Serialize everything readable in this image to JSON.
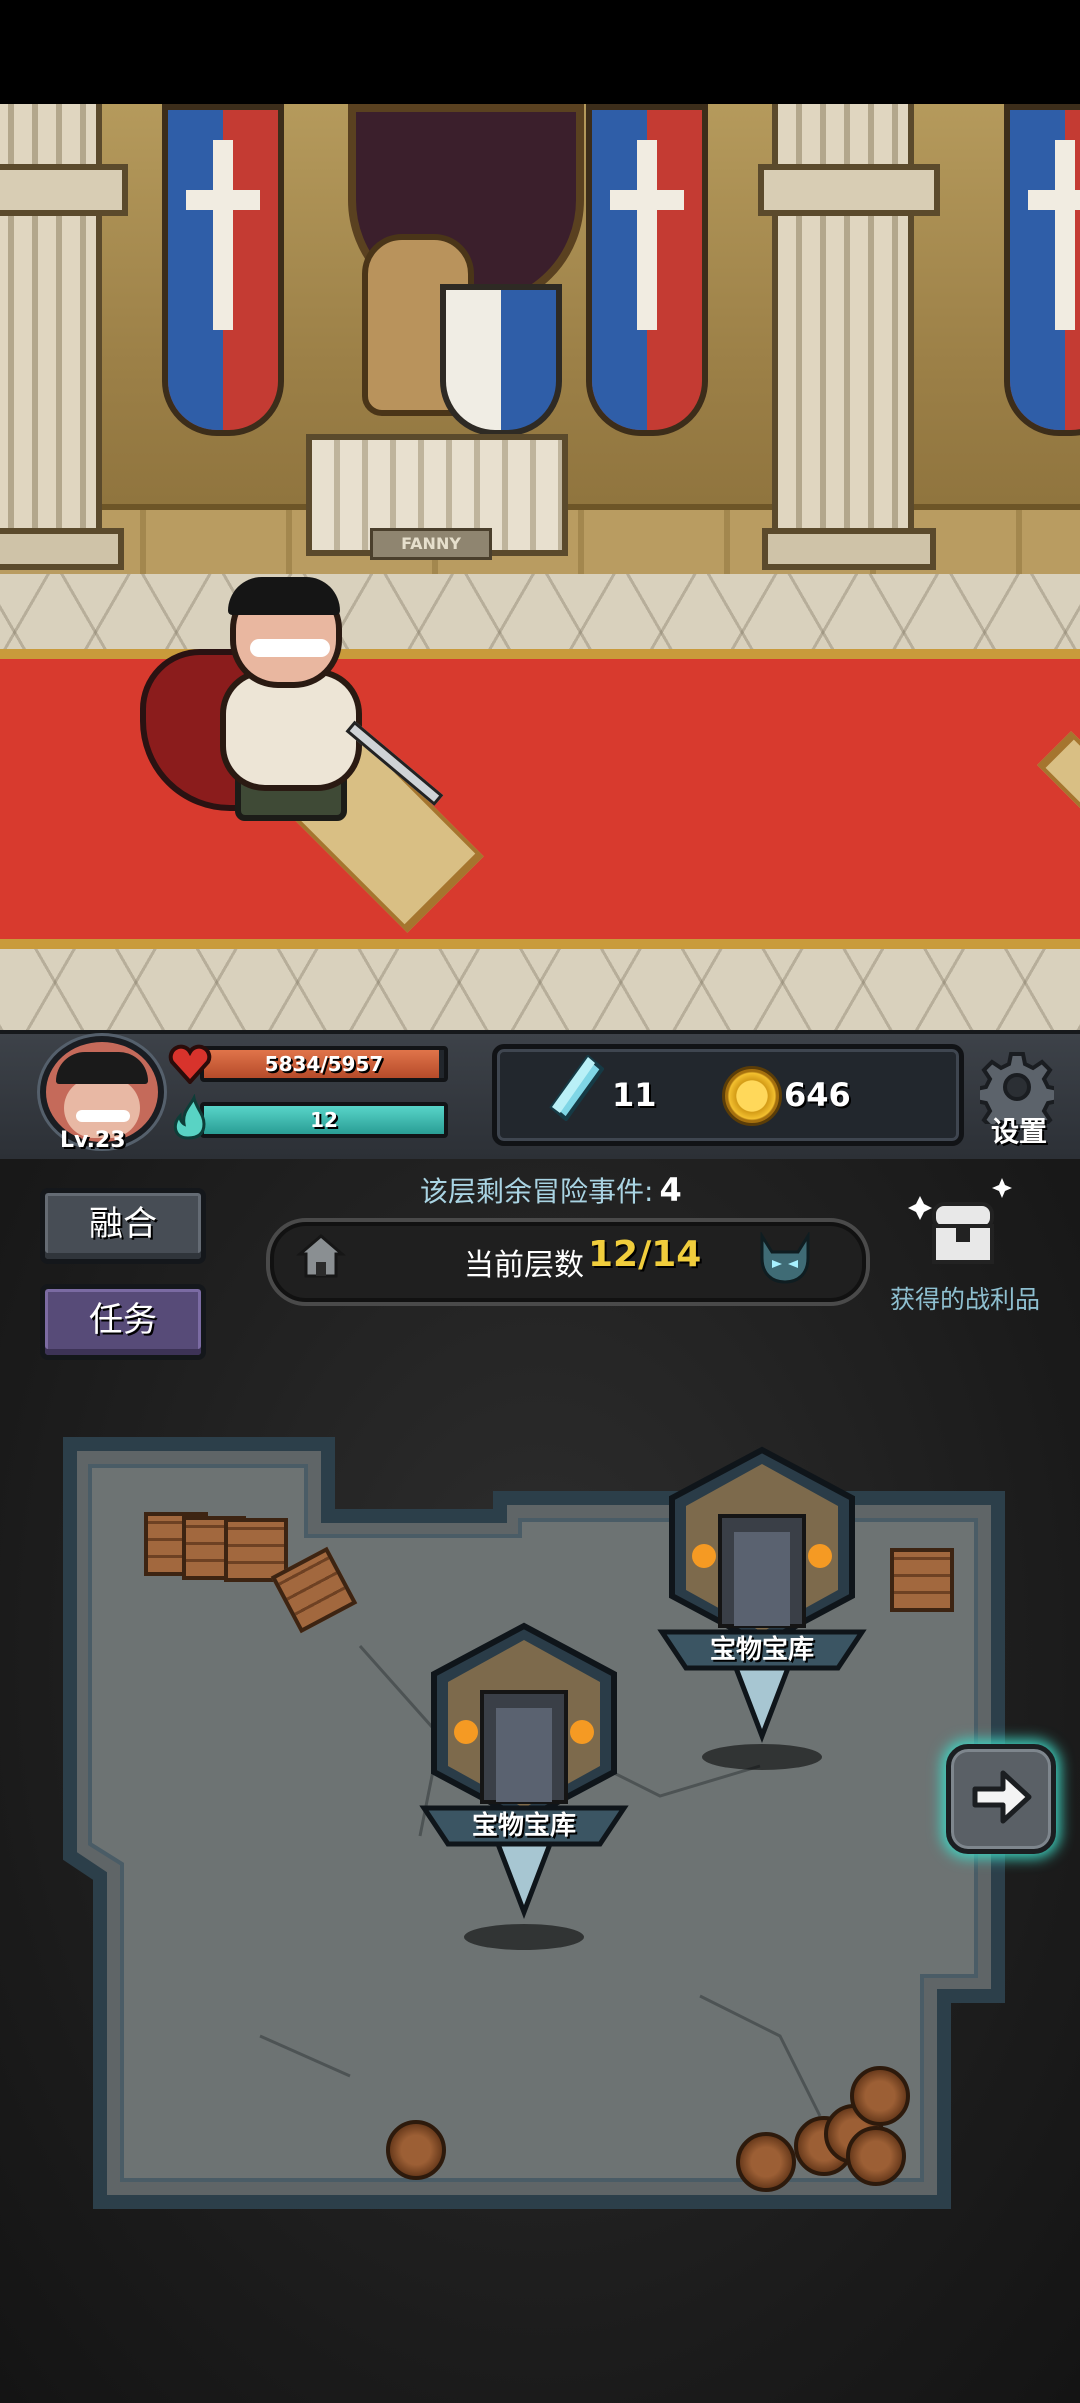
{
  "scene": {
    "plaque_text": "FANNY"
  },
  "hud": {
    "level": "Lv.23",
    "hp_text": "5834/5957",
    "hp_fraction": 0.979,
    "mp_text": "12",
    "mp_fraction": 1.0,
    "crystals": "11",
    "gold": "646",
    "settings_label": "设置"
  },
  "buttons": {
    "fusion": "融合",
    "task": "任务"
  },
  "floor": {
    "events_label": "该层剩余冒险事件:",
    "events_count": "4",
    "current_label": "当前层数",
    "current_value": "12/14"
  },
  "loot": {
    "label": "获得的战利品"
  },
  "map": {
    "nodes": [
      {
        "label": "宝物宝库"
      },
      {
        "label": "宝物宝库"
      }
    ]
  },
  "colors": {
    "hp_fill": "#c85a34",
    "mp_fill": "#3cc0b5",
    "floor_value": "#f0cd3c",
    "next_glow": "#3fd8c5"
  }
}
